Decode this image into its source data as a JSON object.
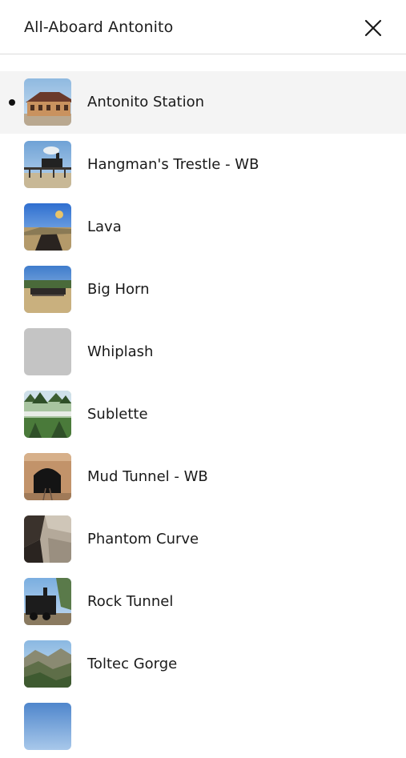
{
  "header": {
    "title": "All-Aboard Antonito",
    "close_icon": "close-icon"
  },
  "stops": [
    {
      "label": "Antonito Station",
      "thumb": "station",
      "active": true
    },
    {
      "label": "Hangman's Trestle - WB",
      "thumb": "trestle",
      "active": false
    },
    {
      "label": "Lava",
      "thumb": "lava",
      "active": false
    },
    {
      "label": "Big Horn",
      "thumb": "bighorn",
      "active": false
    },
    {
      "label": "Whiplash",
      "thumb": "placeholder",
      "active": false
    },
    {
      "label": "Sublette",
      "thumb": "forest",
      "active": false
    },
    {
      "label": "Mud Tunnel - WB",
      "thumb": "tunnel",
      "active": false
    },
    {
      "label": "Phantom Curve",
      "thumb": "rocks",
      "active": false
    },
    {
      "label": "Rock Tunnel",
      "thumb": "locomotive",
      "active": false
    },
    {
      "label": "Toltec Gorge",
      "thumb": "gorge",
      "active": false
    },
    {
      "label": "",
      "thumb": "sky",
      "active": false
    }
  ],
  "colors": {
    "active_row": "#f4f4f4",
    "divider": "#dcdcdc",
    "placeholder_thumb": "#c4c4c4"
  }
}
